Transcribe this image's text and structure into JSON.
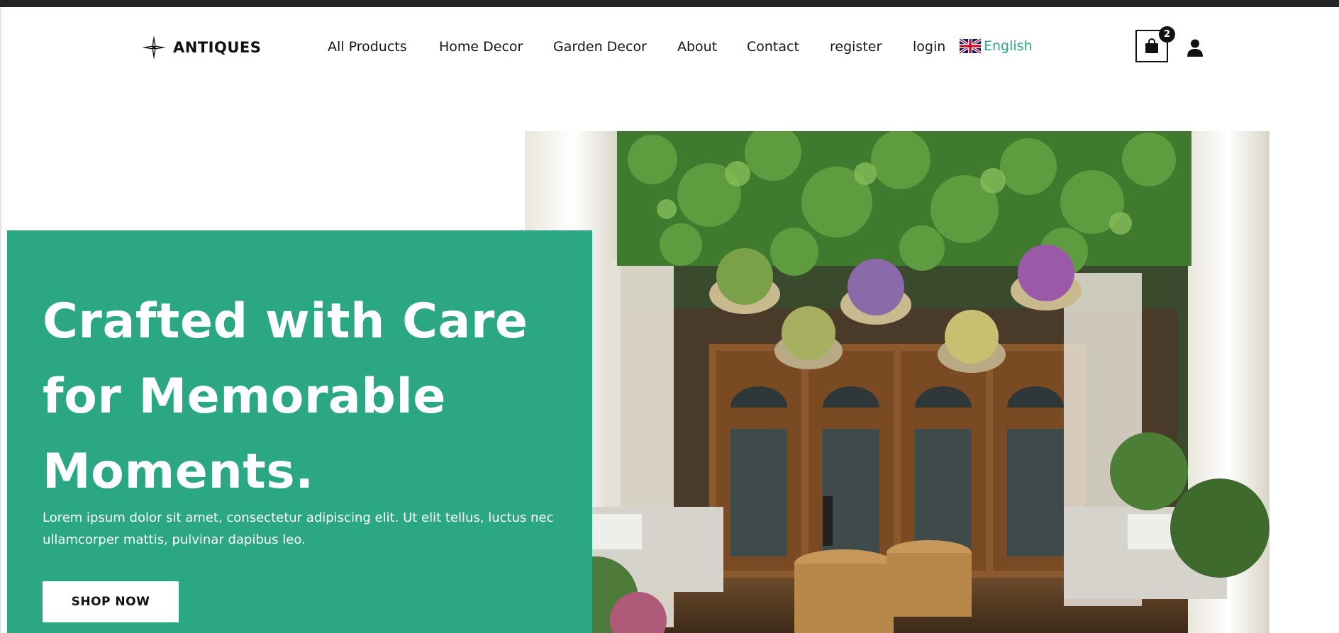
{
  "brand": {
    "name": "ANTIQUES",
    "logo_icon": "compass-star-icon"
  },
  "nav": {
    "items": [
      {
        "label": "All Products"
      },
      {
        "label": "Home Decor"
      },
      {
        "label": "Garden Decor"
      },
      {
        "label": "About"
      },
      {
        "label": "Contact"
      },
      {
        "label": "register"
      },
      {
        "label": "login"
      }
    ],
    "language": {
      "label": "English",
      "flag": "uk-flag-icon"
    }
  },
  "cart": {
    "count": "2",
    "icon": "shopping-bag-icon"
  },
  "user_icon": "user-icon",
  "hero": {
    "title": "Crafted with Care for Memorable Moments.",
    "text": "Lorem ipsum dolor sit amet, consectetur adipiscing elit. Ut elit tellus, luctus nec ullamcorper mattis, pulvinar dapibus leo.",
    "button_label": "SHOP NOW"
  },
  "colors": {
    "accent": "#2ca784",
    "language_link": "#2aa784",
    "text_dark": "#161616",
    "topbar": "#222426"
  }
}
